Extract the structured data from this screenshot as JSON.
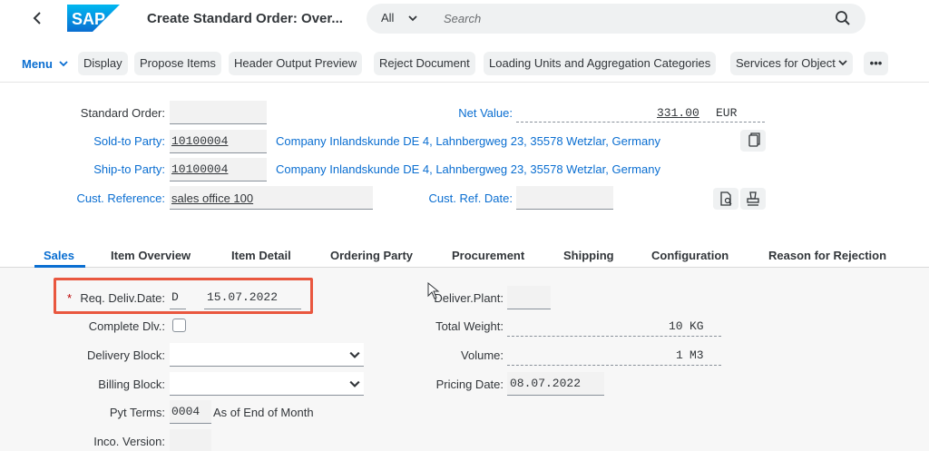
{
  "shell": {
    "back_glyph": "‹",
    "logo_text": "SAP",
    "title": "Create Standard Order: Over...",
    "search_scope": "All",
    "search_placeholder": "Search"
  },
  "toolbar": {
    "menu_label": "Menu",
    "buttons": [
      "Display",
      "Propose Items",
      "Header Output Preview",
      "Reject Document",
      "Loading Units and Aggregation Categories",
      "Services for Object"
    ],
    "overflow_label": "•••"
  },
  "header": {
    "standard_order_label": "Standard Order:",
    "standard_order_value": "",
    "sold_to_label": "Sold-to Party:",
    "sold_to_value": "10100004",
    "sold_to_desc": "Company Inlandskunde DE 4, Lahnbergweg 23, 35578 Wetzlar, Germany",
    "ship_to_label": "Ship-to Party:",
    "ship_to_value": "10100004",
    "ship_to_desc": "Company Inlandskunde DE 4, Lahnbergweg 23, 35578 Wetzlar, Germany",
    "cust_ref_label": "Cust. Reference:",
    "cust_ref_value": "sales office 100",
    "net_value_label": "Net Value:",
    "net_value": "331.00",
    "net_currency": "EUR",
    "cust_ref_date_label": "Cust. Ref. Date:",
    "cust_ref_date_value": ""
  },
  "tabs": [
    "Sales",
    "Item Overview",
    "Item Detail",
    "Ordering Party",
    "Procurement",
    "Shipping",
    "Configuration",
    "Reason for Rejection"
  ],
  "sales": {
    "req_deliv_required": "*",
    "req_deliv_label": "Req. Deliv.Date:",
    "req_deliv_type": "D",
    "req_deliv_date": "15.07.2022",
    "complete_dlv_label": "Complete Dlv.:",
    "delivery_block_label": "Delivery Block:",
    "billing_block_label": "Billing Block:",
    "pyt_terms_label": "Pyt Terms:",
    "pyt_terms_value": "0004",
    "pyt_terms_desc": "As of End of Month",
    "inco_version_label": "Inco. Version:",
    "deliver_plant_label": "Deliver.Plant:",
    "total_weight_label": "Total Weight:",
    "total_weight_value": "10",
    "total_weight_unit": "KG",
    "volume_label": "Volume:",
    "volume_value": "1",
    "volume_unit": "M3",
    "pricing_date_label": "Pricing Date:",
    "pricing_date_value": "08.07.2022"
  },
  "colors": {
    "accent": "#0a6ed1",
    "highlight": "#e9573f"
  }
}
